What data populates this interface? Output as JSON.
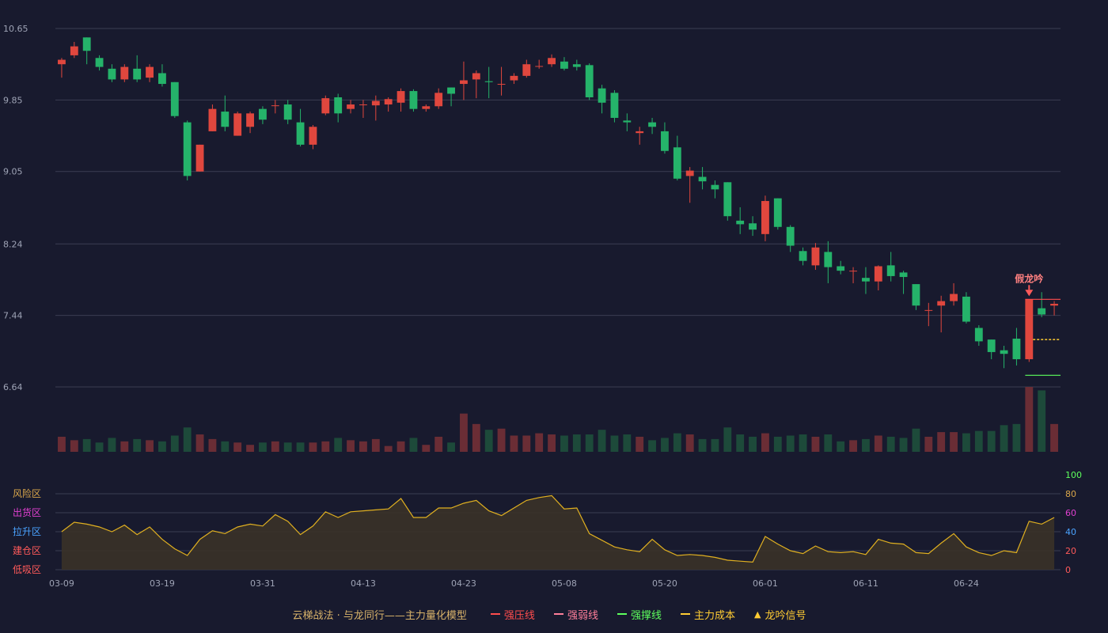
{
  "chart_data": {
    "type": "candlestick",
    "price_axis": {
      "ticks": [
        "10.65",
        "9.85",
        "9.05",
        "8.24",
        "7.44",
        "6.64"
      ],
      "ylim": [
        6.64,
        10.65
      ]
    },
    "indicator_axis": {
      "right_ticks": [
        "100",
        "80",
        "60",
        "40",
        "20",
        "0"
      ],
      "ylim": [
        0,
        100
      ]
    },
    "zones": [
      {
        "label": "风险区",
        "color": "#d9a64a"
      },
      {
        "label": "出货区",
        "color": "#e040d0"
      },
      {
        "label": "拉升区",
        "color": "#4aa3ff"
      },
      {
        "label": "建仓区",
        "color": "#ff5a5a"
      },
      {
        "label": "低吸区",
        "color": "#ff5a5a"
      }
    ],
    "x_tick_labels": [
      {
        "i": 0,
        "label": "03-09"
      },
      {
        "i": 8,
        "label": "03-19"
      },
      {
        "i": 16,
        "label": "03-31"
      },
      {
        "i": 24,
        "label": "04-13"
      },
      {
        "i": 32,
        "label": "04-23"
      },
      {
        "i": 40,
        "label": "05-08"
      },
      {
        "i": 48,
        "label": "05-20"
      },
      {
        "i": 56,
        "label": "06-01"
      },
      {
        "i": 64,
        "label": "06-11"
      },
      {
        "i": 72,
        "label": "06-24"
      }
    ],
    "candles": [
      [
        10.25,
        10.3,
        10.32,
        10.1
      ],
      [
        10.35,
        10.45,
        10.5,
        10.32
      ],
      [
        10.55,
        10.4,
        10.55,
        10.25
      ],
      [
        10.32,
        10.22,
        10.35,
        10.18
      ],
      [
        10.2,
        10.08,
        10.25,
        10.05
      ],
      [
        10.08,
        10.22,
        10.25,
        10.05
      ],
      [
        10.2,
        10.08,
        10.35,
        10.05
      ],
      [
        10.1,
        10.22,
        10.25,
        10.05
      ],
      [
        10.15,
        10.03,
        10.25,
        10.0
      ],
      [
        10.05,
        9.67,
        10.05,
        9.65
      ],
      [
        9.6,
        9.0,
        9.62,
        8.95
      ],
      [
        9.05,
        9.35,
        9.35,
        9.05
      ],
      [
        9.5,
        9.75,
        9.8,
        9.5
      ],
      [
        9.72,
        9.55,
        9.9,
        9.5
      ],
      [
        9.45,
        9.7,
        9.72,
        9.45
      ],
      [
        9.55,
        9.7,
        9.72,
        9.48
      ],
      [
        9.75,
        9.63,
        9.78,
        9.58
      ],
      [
        9.79,
        9.79,
        9.85,
        9.7
      ],
      [
        9.8,
        9.63,
        9.85,
        9.58
      ],
      [
        9.6,
        9.35,
        9.75,
        9.33
      ],
      [
        9.35,
        9.55,
        9.57,
        9.3
      ],
      [
        9.7,
        9.87,
        9.9,
        9.68
      ],
      [
        9.88,
        9.7,
        9.92,
        9.6
      ],
      [
        9.75,
        9.8,
        9.85,
        9.7
      ],
      [
        9.8,
        9.8,
        9.85,
        9.65
      ],
      [
        9.79,
        9.84,
        9.9,
        9.62
      ],
      [
        9.8,
        9.86,
        9.88,
        9.72
      ],
      [
        9.82,
        9.95,
        9.98,
        9.72
      ],
      [
        9.95,
        9.75,
        9.97,
        9.72
      ],
      [
        9.75,
        9.78,
        9.8,
        9.72
      ],
      [
        9.78,
        9.93,
        9.98,
        9.75
      ],
      [
        9.99,
        9.92,
        9.99,
        9.78
      ],
      [
        10.03,
        10.07,
        10.28,
        9.85
      ],
      [
        10.08,
        10.15,
        10.18,
        9.87
      ],
      [
        10.06,
        10.05,
        10.22,
        9.87
      ],
      [
        10.03,
        10.03,
        10.22,
        9.9
      ],
      [
        10.07,
        10.12,
        10.15,
        10.03
      ],
      [
        10.12,
        10.25,
        10.3,
        10.1
      ],
      [
        10.23,
        10.23,
        10.3,
        10.2
      ],
      [
        10.25,
        10.32,
        10.36,
        10.22
      ],
      [
        10.28,
        10.2,
        10.33,
        10.18
      ],
      [
        10.25,
        10.22,
        10.3,
        10.18
      ],
      [
        10.24,
        9.88,
        10.26,
        9.85
      ],
      [
        9.98,
        9.82,
        10.02,
        9.7
      ],
      [
        9.93,
        9.65,
        9.96,
        9.6
      ],
      [
        9.62,
        9.6,
        9.7,
        9.5
      ],
      [
        9.48,
        9.5,
        9.55,
        9.35
      ],
      [
        9.6,
        9.55,
        9.65,
        9.47
      ],
      [
        9.5,
        9.28,
        9.6,
        9.25
      ],
      [
        9.32,
        8.97,
        9.45,
        8.95
      ],
      [
        9.0,
        9.06,
        9.1,
        8.7
      ],
      [
        8.99,
        8.94,
        9.1,
        8.85
      ],
      [
        8.9,
        8.85,
        8.95,
        8.75
      ],
      [
        8.93,
        8.55,
        8.93,
        8.5
      ],
      [
        8.5,
        8.46,
        8.65,
        8.35
      ],
      [
        8.47,
        8.4,
        8.55,
        8.33
      ],
      [
        8.35,
        8.72,
        8.78,
        8.27
      ],
      [
        8.75,
        8.43,
        8.75,
        8.4
      ],
      [
        8.43,
        8.22,
        8.45,
        8.15
      ],
      [
        8.16,
        8.05,
        8.2,
        8.0
      ],
      [
        8.0,
        8.2,
        8.25,
        7.95
      ],
      [
        8.15,
        7.98,
        8.27,
        7.8
      ],
      [
        7.99,
        7.94,
        8.05,
        7.9
      ],
      [
        7.94,
        7.94,
        7.98,
        7.8
      ],
      [
        7.86,
        7.82,
        7.98,
        7.68
      ],
      [
        7.82,
        7.99,
        8.0,
        7.72
      ],
      [
        8.0,
        7.88,
        8.15,
        7.82
      ],
      [
        7.92,
        7.87,
        7.94,
        7.68
      ],
      [
        7.79,
        7.55,
        7.79,
        7.5
      ],
      [
        7.5,
        7.5,
        7.58,
        7.32
      ],
      [
        7.55,
        7.6,
        7.66,
        7.25
      ],
      [
        7.6,
        7.68,
        7.8,
        7.55
      ],
      [
        7.65,
        7.37,
        7.7,
        7.35
      ],
      [
        7.3,
        7.15,
        7.33,
        7.1
      ],
      [
        7.17,
        7.03,
        7.17,
        6.95
      ],
      [
        7.05,
        7.01,
        7.1,
        6.85
      ],
      [
        7.18,
        6.95,
        7.3,
        6.88
      ],
      [
        6.95,
        7.62,
        7.62,
        6.92
      ],
      [
        7.52,
        7.45,
        7.7,
        7.42
      ],
      [
        7.55,
        7.57,
        7.6,
        7.44
      ]
    ],
    "volume": [
      13,
      10,
      11,
      8,
      12,
      9,
      11,
      10,
      9,
      14,
      21,
      15,
      11,
      9,
      8,
      6,
      8,
      9,
      8,
      8,
      8,
      9,
      12,
      10,
      9,
      11,
      5,
      9,
      12,
      6,
      13,
      8,
      33,
      24,
      19,
      20,
      14,
      14,
      16,
      15,
      14,
      15,
      15,
      19,
      14,
      15,
      13,
      10,
      12,
      16,
      15,
      11,
      11,
      21,
      15,
      13,
      16,
      13,
      14,
      15,
      13,
      15,
      9,
      10,
      11,
      14,
      13,
      12,
      20,
      13,
      17,
      17,
      16,
      18,
      18,
      23,
      24,
      56,
      53,
      24
    ],
    "indicator": [
      40,
      50,
      48,
      45,
      40,
      47,
      37,
      45,
      32,
      22,
      15,
      32,
      41,
      38,
      45,
      48,
      46,
      58,
      51,
      37,
      46,
      61,
      55,
      61,
      62,
      63,
      64,
      75,
      55,
      55,
      65,
      65,
      70,
      73,
      62,
      57,
      65,
      73,
      76,
      78,
      64,
      65,
      38,
      31,
      24,
      21,
      19,
      32,
      21,
      15,
      16,
      15,
      13,
      10,
      9,
      8,
      35,
      27,
      20,
      17,
      25,
      19,
      18,
      19,
      16,
      32,
      28,
      27,
      18,
      17,
      28,
      38,
      24,
      18,
      15,
      20,
      18,
      51,
      48,
      55
    ],
    "lines": {
      "strong_pressure": {
        "start": 77,
        "value": 7.62
      },
      "main_cost": {
        "start": 77,
        "value": 7.17
      },
      "strong_support": {
        "start": 77,
        "value": 6.77
      }
    },
    "annotation": {
      "i": 77,
      "text": "假龙吟"
    },
    "colors": {
      "up": "#e0473e",
      "down": "#25b36a",
      "up_vol": "#6a2d35",
      "down_vol": "#1d4a3a",
      "grid": "#3a3d52",
      "axis_text": "#9ea3b5",
      "indicator_line": "#e0b020",
      "indicator_fill": "#3a3228"
    }
  },
  "legend": {
    "title": "云梯战法 · 与龙同行——主力量化模型",
    "items": [
      {
        "label": "强压线",
        "color": "#ff4d4d",
        "style": "solid"
      },
      {
        "label": "强弱线",
        "color": "#ff7f9a",
        "style": "dash"
      },
      {
        "label": "强撑线",
        "color": "#5dff5d",
        "style": "solid"
      },
      {
        "label": "主力成本",
        "color": "#ffcc33",
        "style": "dash"
      },
      {
        "label": "龙吟信号",
        "color": "#ffcc33",
        "style": "triangle",
        "glyph": "▲"
      }
    ]
  }
}
